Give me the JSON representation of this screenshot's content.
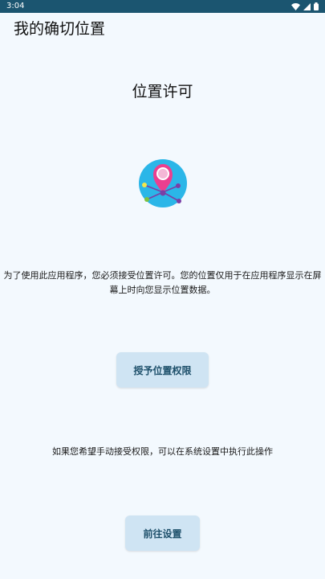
{
  "status_bar": {
    "time": "3:04",
    "icons": [
      "wifi-icon",
      "signal-icon",
      "battery-icon"
    ]
  },
  "app": {
    "title": "我的确切位置"
  },
  "main": {
    "heading": "位置许可",
    "icon": "location-pin-network-icon",
    "description": "为了使用此应用程序，您必须接受位置许可。您的位置仅用于在应用程序显示在屏幕上时向您显示位置数据。",
    "grant_button_label": "授予位置权限",
    "manual_text": "如果您希望手动接受权限，可以在系统设置中执行此操作",
    "settings_button_label": "前往设置"
  },
  "colors": {
    "background": "#f3f9fe",
    "status_bar": "#1b5570",
    "button_bg": "#cfe4f3",
    "button_text": "#1d4f6a",
    "pin_pink": "#ec3f8f",
    "icon_circle": "#2bb6e8"
  }
}
